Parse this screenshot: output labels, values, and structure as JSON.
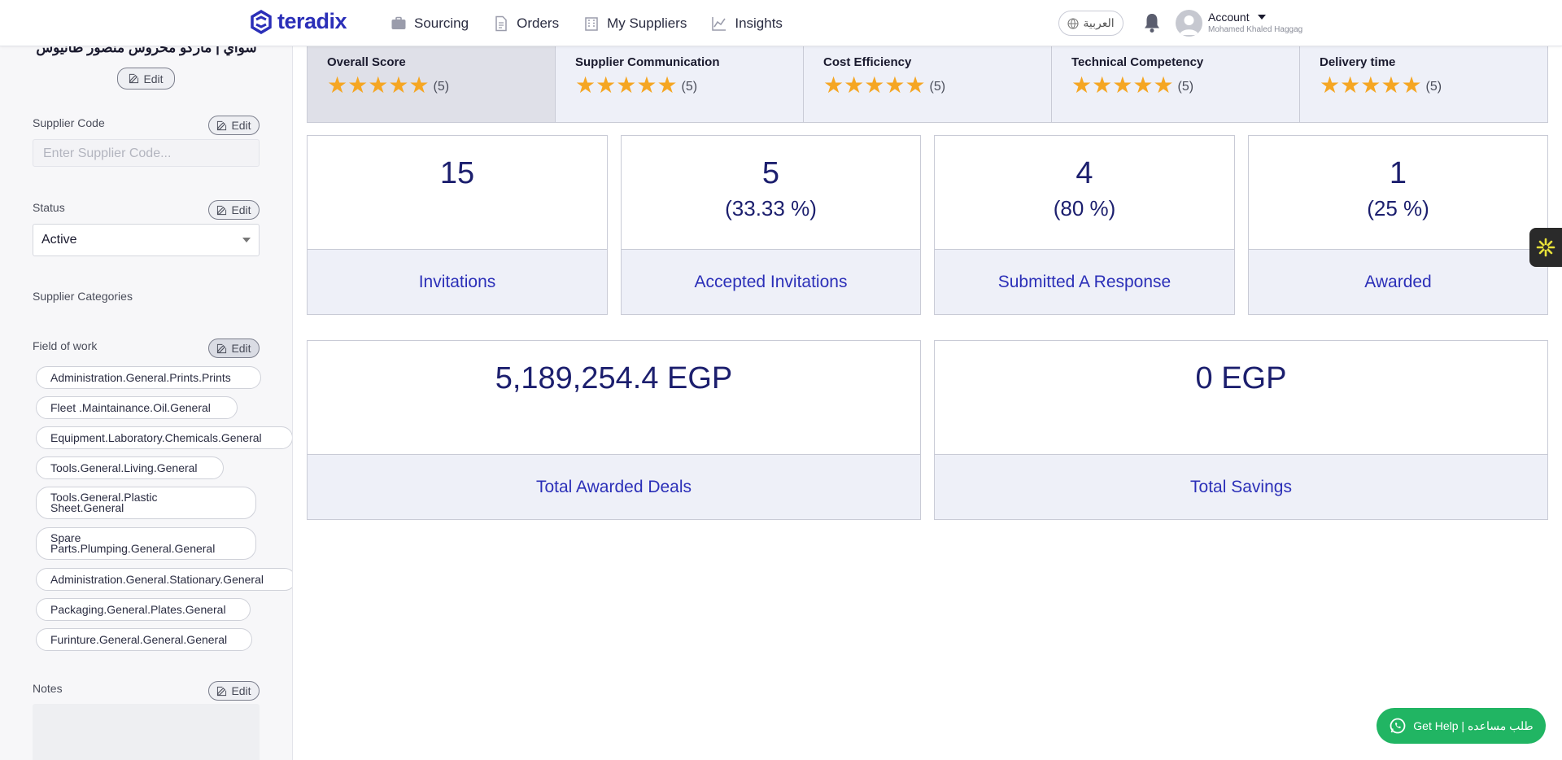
{
  "header": {
    "brand": "teradix",
    "nav": [
      "Sourcing",
      "Orders",
      "My Suppliers",
      "Insights"
    ],
    "language_label": "العربية",
    "account_label": "Account",
    "account_name": "Mohamed Khaled Haggag"
  },
  "sidebar": {
    "supplier_name": "سواي | ماركو محروس منصور طانيوس",
    "edit_label": "Edit",
    "supplier_code_label": "Supplier Code",
    "supplier_code_placeholder": "Enter Supplier Code...",
    "status_label": "Status",
    "status_value": "Active",
    "categories_label": "Supplier Categories",
    "field_of_work_label": "Field of work",
    "fields_of_work": [
      "Administration.General.Prints.Prints",
      "Fleet .Maintainance.Oil.General",
      "Equipment.Laboratory.Chemicals.General",
      "Tools.General.Living.General",
      "Tools.General.Plastic Sheet.General",
      "Spare Parts.Plumping.General.General",
      "Administration.General.Stationary.General",
      "Packaging.General.Plates.General",
      "Furinture.General.General.General"
    ],
    "notes_label": "Notes"
  },
  "scores": [
    {
      "title": "Overall Score",
      "rating": 5,
      "value": "(5)"
    },
    {
      "title": "Supplier Communication",
      "rating": 5,
      "value": "(5)"
    },
    {
      "title": "Cost Efficiency",
      "rating": 5,
      "value": "(5)"
    },
    {
      "title": "Technical Competency",
      "rating": 5,
      "value": "(5)"
    },
    {
      "title": "Delivery time",
      "rating": 5,
      "value": "(5)"
    }
  ],
  "stats": [
    {
      "number": "15",
      "percent": "",
      "label": "Invitations"
    },
    {
      "number": "5",
      "percent": "(33.33 %)",
      "label": "Accepted Invitations"
    },
    {
      "number": "4",
      "percent": "(80 %)",
      "label": "Submitted A Response"
    },
    {
      "number": "1",
      "percent": "(25 %)",
      "label": "Awarded"
    }
  ],
  "totals": [
    {
      "amount": "5,189,254.4 EGP",
      "label": "Total Awarded Deals"
    },
    {
      "amount": "0 EGP",
      "label": "Total Savings"
    }
  ],
  "help": {
    "label": "Get Help | طلب مساعده"
  },
  "colors": {
    "brand": "#2b2fb8",
    "star": "#f5a623",
    "help": "#21b563"
  }
}
